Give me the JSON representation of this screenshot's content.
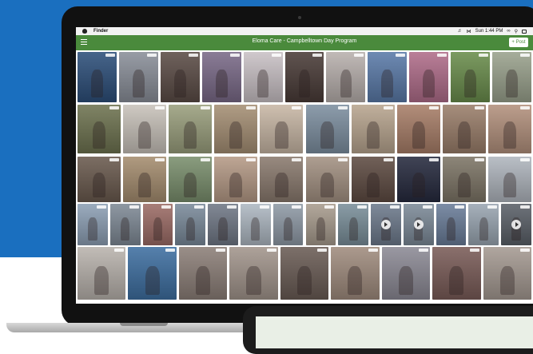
{
  "menubar": {
    "app_name": "Finder",
    "clock": "Sun 1:44 PM"
  },
  "appbar": {
    "title": "Eloma Care - Campbelltown Day Program",
    "post_label": "+ Post"
  },
  "icons": {
    "menu": "hamburger-icon",
    "apple": "apple-icon",
    "volume": "volume-icon",
    "bluetooth": "bluetooth-icon",
    "wifi": "wifi-icon",
    "search": "search-icon",
    "list": "list-icon",
    "play": "play-icon"
  },
  "colors": {
    "page_background": "#1a6fbf",
    "app_header": "#4a8a3c",
    "menubar": "#f2f2f2"
  },
  "gallery": {
    "rows": [
      {
        "photos": [
          {
            "color": "#2d4f7a"
          },
          {
            "color": "#8a8f99"
          },
          {
            "color": "#5b4c46"
          },
          {
            "color": "#7a6a88"
          },
          {
            "color": "#c9c1c5"
          },
          {
            "color": "#4a3c38"
          },
          {
            "color": "#b8b0ad"
          },
          {
            "color": "#5a7aa8"
          },
          {
            "color": "#b06d8a"
          },
          {
            "color": "#6a8d4c"
          },
          {
            "color": "#9aa28d"
          }
        ]
      },
      {
        "photos": [
          {
            "color": "#6e7350"
          },
          {
            "color": "#c8c2ba"
          },
          {
            "color": "#9a9f7d"
          },
          {
            "color": "#a58f74"
          },
          {
            "color": "#c8b7a5"
          },
          {
            "color": "#7d8fa0"
          },
          {
            "color": "#b8a58f"
          },
          {
            "color": "#a87e68"
          },
          {
            "color": "#9a7e6a"
          },
          {
            "color": "#b3917d"
          }
        ]
      },
      {
        "photos": [
          {
            "color": "#6a5a4e"
          },
          {
            "color": "#a58d6f"
          },
          {
            "color": "#7a8f6d"
          },
          {
            "color": "#b59a86"
          },
          {
            "color": "#8a7a6e"
          },
          {
            "color": "#a39182"
          },
          {
            "color": "#5e4b42"
          },
          {
            "color": "#262a3e"
          },
          {
            "color": "#7d7566"
          },
          {
            "color": "#b0b6be"
          }
        ]
      },
      {
        "photos": [
          {
            "color": "#8da0b5"
          },
          {
            "color": "#7f8a96"
          },
          {
            "color": "#9c6c66"
          },
          {
            "color": "#7a8a9a"
          },
          {
            "color": "#707886"
          },
          {
            "color": "#aeb8c2"
          },
          {
            "color": "#8f9aa6"
          },
          {
            "color": "#a89c8e"
          },
          {
            "color": "#7a8f9a"
          },
          {
            "color": "#6d7a8c",
            "video": true
          },
          {
            "color": "#7c8a98",
            "video": true
          },
          {
            "color": "#6a7d99"
          },
          {
            "color": "#9aa6b2"
          },
          {
            "color": "#5a6068",
            "video": true
          }
        ]
      },
      {
        "photos": [
          {
            "color": "#b9b3ad"
          },
          {
            "color": "#3e6fa1"
          },
          {
            "color": "#8c7f78"
          },
          {
            "color": "#a2958c"
          },
          {
            "color": "#6a5c55"
          },
          {
            "color": "#a08c7e"
          },
          {
            "color": "#8c8a95"
          },
          {
            "color": "#7a5c58"
          },
          {
            "color": "#a59a92"
          }
        ]
      }
    ]
  }
}
